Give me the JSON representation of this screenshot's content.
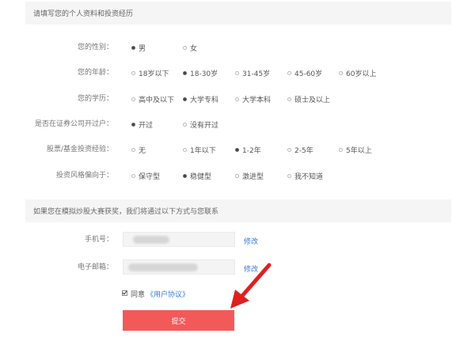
{
  "profile_header": {
    "title": "请填写您的个人资料和投资经历"
  },
  "profile": {
    "gender": {
      "label": "您的性别：",
      "options": [
        "男",
        "女"
      ],
      "selected": "男"
    },
    "age": {
      "label": "您的年龄：",
      "options": [
        "18岁以下",
        "18-30岁",
        "31-45岁",
        "45-60岁",
        "60岁以上"
      ],
      "selected": "18-30岁"
    },
    "education": {
      "label": "您的学历：",
      "options": [
        "高中及以下",
        "大学专科",
        "大学本科",
        "硕士及以上"
      ],
      "selected": "大学专科"
    },
    "account": {
      "label": "是否在证券公司开过户：",
      "options": [
        "开过",
        "没有开过"
      ],
      "selected": "开过"
    },
    "experience": {
      "label": "股票/基金投资经验：",
      "options": [
        "无",
        "1年以下",
        "1-2年",
        "2-5年",
        "5年以上"
      ],
      "selected": "1-2年"
    },
    "style": {
      "label": "投资风格偏向于：",
      "options": [
        "保守型",
        "稳健型",
        "激进型",
        "我不知道"
      ],
      "selected": "稳健型"
    }
  },
  "contact_header": {
    "title": "如果您在模拟炒股大赛获奖，我们将通过以下方式与您联系"
  },
  "contact": {
    "phone": {
      "label": "手机号：",
      "modify_label": "修改"
    },
    "email": {
      "label": "电子邮箱：",
      "modify_label": "修改"
    }
  },
  "agreement": {
    "checked": true,
    "text": "同意",
    "link_text": "《用户协议》"
  },
  "submit": {
    "label": "提交",
    "color": "#f25a5a"
  },
  "colors": {
    "link": "#3a7bd5",
    "header_bg": "#f5f5f5",
    "arrow": "#e02020"
  }
}
